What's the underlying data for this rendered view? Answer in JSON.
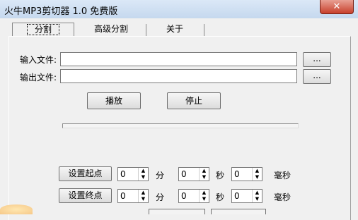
{
  "window": {
    "title": "火牛MP3剪切器 1.0 免费版",
    "close_glyph": "✕"
  },
  "tabs": [
    {
      "label": "分割",
      "active": true
    },
    {
      "label": "高级分割",
      "active": false
    },
    {
      "label": "关于",
      "active": false
    }
  ],
  "input": {
    "label": "输入文件:",
    "value": "",
    "browse_label": "..."
  },
  "output": {
    "label": "输出文件:",
    "value": "",
    "browse_label": "..."
  },
  "play_label": "播放",
  "stop_label": "停止",
  "progress": {
    "fraction": 0.0
  },
  "start_row": {
    "button": "设置起点",
    "min": "0",
    "min_unit": "分",
    "sec": "0",
    "sec_unit": "秒",
    "ms": "0",
    "ms_unit": "毫秒"
  },
  "end_row": {
    "button": "设置终点",
    "min": "0",
    "min_unit": "分",
    "sec": "0",
    "sec_unit": "秒",
    "ms": "0",
    "ms_unit": "毫秒"
  },
  "icons": {
    "spin_up": "▲",
    "spin_down": "▼"
  }
}
